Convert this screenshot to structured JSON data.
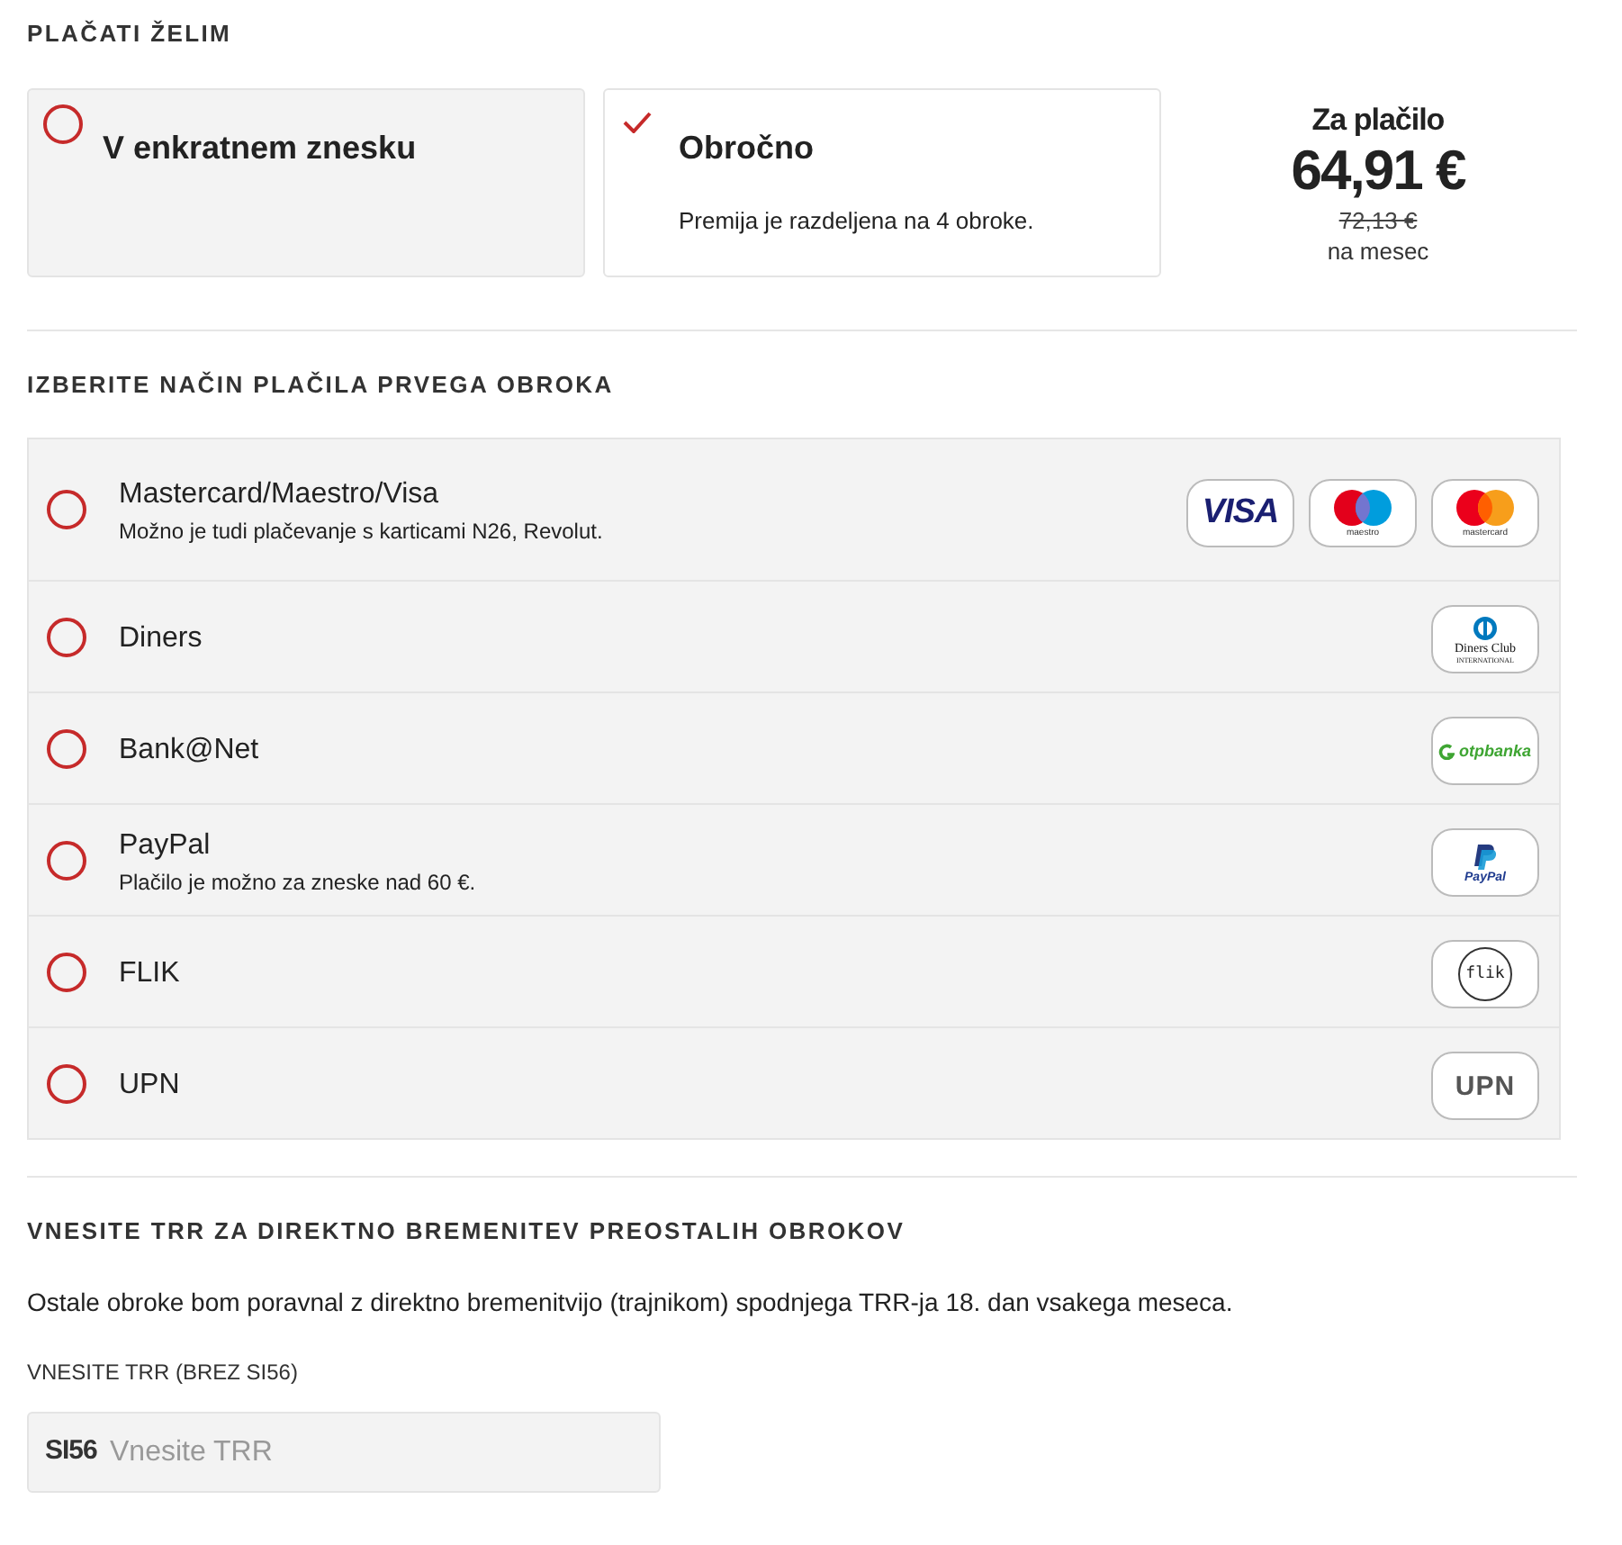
{
  "payment_type": {
    "heading": "PLAČATI ŽELIM",
    "options": [
      {
        "label": "V enkratnem znesku",
        "selected": false
      },
      {
        "label": "Obročno",
        "description": "Premija je razdeljena na 4 obroke.",
        "selected": true
      }
    ],
    "price": {
      "label": "Za plačilo",
      "amount": "64,91 €",
      "old_amount": "72,13 €",
      "period": "na mesec"
    }
  },
  "first_payment": {
    "heading": "IZBERITE NAČIN PLAČILA PRVEGA OBROKA",
    "methods": [
      {
        "label": "Mastercard/Maestro/Visa",
        "note": "Možno je tudi plačevanje s karticami N26, Revolut.",
        "selected": false,
        "logos": [
          {
            "kind": "visa",
            "text": "VISA"
          },
          {
            "kind": "maestro",
            "text": "maestro"
          },
          {
            "kind": "mastercard",
            "text": "mastercard"
          }
        ]
      },
      {
        "label": "Diners",
        "selected": false,
        "logos": [
          {
            "kind": "diners",
            "text": "Diners Club",
            "subtext": "INTERNATIONAL"
          }
        ]
      },
      {
        "label": "Bank@Net",
        "selected": false,
        "logos": [
          {
            "kind": "otp",
            "text": "otpbanka"
          }
        ]
      },
      {
        "label": "PayPal",
        "note": "Plačilo je možno za zneske nad 60 €.",
        "selected": false,
        "logos": [
          {
            "kind": "paypal",
            "text": "PayPal"
          }
        ]
      },
      {
        "label": "FLIK",
        "selected": false,
        "logos": [
          {
            "kind": "flik",
            "text": "flik"
          }
        ]
      },
      {
        "label": "UPN",
        "selected": false,
        "logos": [
          {
            "kind": "upn",
            "text": "UPN"
          }
        ]
      }
    ]
  },
  "direct_debit": {
    "heading": "VNESITE TRR ZA DIREKTNO BREMENITEV PREOSTALIH OBROKOV",
    "text": "Ostale obroke bom poravnal z direktno bremenitvijo (trajnikom) spodnjega TRR-ja 18. dan vsakega meseca.",
    "field": {
      "label": "VNESITE TRR (BREZ SI56)",
      "prefix": "SI56",
      "placeholder": "Vnesite TRR"
    }
  }
}
